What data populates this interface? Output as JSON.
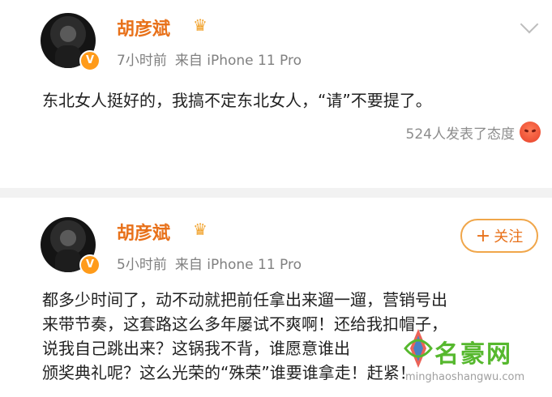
{
  "posts": [
    {
      "author": "胡彦斌",
      "time": "7小时前",
      "source": "来自 iPhone 11 Pro",
      "text": "东北女人挺好的，我搞不定东北女人，“请”不要提了。",
      "reactions": "524人发表了态度"
    },
    {
      "author": "胡彦斌",
      "time": "5小时前",
      "source": "来自 iPhone 11 Pro",
      "follow_label": "关注",
      "lines": [
        "都多少时间了，动不动就把前任拿出来遛一遛，营销号出",
        "来带节奏，这套路这么多年屡试不爽啊！还给我扣帽子，",
        "说我自己跳出来？这锅我不背，谁愿意谁出",
        "颁奖典礼呢？这么光荣的“殊荣”谁要谁拿走！赶紧！"
      ]
    }
  ],
  "watermark": {
    "title": "名豪网",
    "url": "minghaoshangwu.com"
  },
  "colors": {
    "name": "#e8711a",
    "badge": "#ff9b1a",
    "follow_border": "#f0a64a",
    "watermark": "#56b82e"
  },
  "icons": {
    "crown": "crown-icon",
    "verified": "verified-v-icon",
    "chevron": "chevron-down-icon",
    "reaction": "angry-face-icon",
    "plus": "plus-icon"
  }
}
